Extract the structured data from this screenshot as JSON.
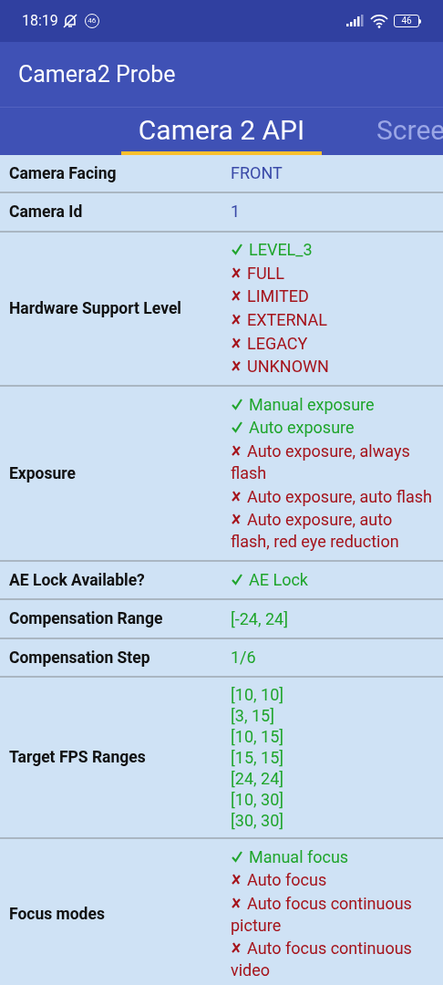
{
  "status_bar": {
    "time": "18:19",
    "notification_count": "46",
    "battery": "46"
  },
  "app_bar": {
    "title": "Camera2 Probe"
  },
  "tabs": [
    {
      "label": "Camera 2 API",
      "selected": true
    },
    {
      "label": "Scree",
      "selected": false
    }
  ],
  "rows": [
    {
      "label": "Camera Facing",
      "values": [
        {
          "kind": "info",
          "text": "FRONT"
        }
      ]
    },
    {
      "label": "Camera Id",
      "values": [
        {
          "kind": "info",
          "text": "1"
        }
      ]
    },
    {
      "label": "Hardware Support Level",
      "values": [
        {
          "kind": "feature",
          "text": "LEVEL_3",
          "supported": true
        },
        {
          "kind": "feature",
          "text": "FULL",
          "supported": false
        },
        {
          "kind": "feature",
          "text": "LIMITED",
          "supported": false
        },
        {
          "kind": "feature",
          "text": "EXTERNAL",
          "supported": false
        },
        {
          "kind": "feature",
          "text": "LEGACY",
          "supported": false
        },
        {
          "kind": "feature",
          "text": "UNKNOWN",
          "supported": false
        }
      ]
    },
    {
      "label": "Exposure",
      "values": [
        {
          "kind": "feature",
          "text": "Manual exposure",
          "supported": true
        },
        {
          "kind": "feature",
          "text": "Auto exposure",
          "supported": true
        },
        {
          "kind": "feature",
          "text": "Auto exposure, always flash",
          "supported": false
        },
        {
          "kind": "feature",
          "text": "Auto exposure, auto flash",
          "supported": false
        },
        {
          "kind": "feature",
          "text": "Auto exposure, auto flash, red eye reduction",
          "supported": false
        }
      ]
    },
    {
      "label": "AE Lock Available?",
      "values": [
        {
          "kind": "feature",
          "text": "AE Lock",
          "supported": true
        }
      ]
    },
    {
      "label": "Compensation Range",
      "values": [
        {
          "kind": "value",
          "text": "[-24, 24]"
        }
      ]
    },
    {
      "label": "Compensation Step",
      "values": [
        {
          "kind": "value",
          "text": "1/6"
        }
      ]
    },
    {
      "label": "Target FPS Ranges",
      "values": [
        {
          "kind": "value",
          "text": "[10, 10]"
        },
        {
          "kind": "value",
          "text": "[3, 15]"
        },
        {
          "kind": "value",
          "text": "[10, 15]"
        },
        {
          "kind": "value",
          "text": "[15, 15]"
        },
        {
          "kind": "value",
          "text": "[24, 24]"
        },
        {
          "kind": "value",
          "text": "[10, 30]"
        },
        {
          "kind": "value",
          "text": "[30, 30]"
        }
      ]
    },
    {
      "label": "Focus modes",
      "values": [
        {
          "kind": "feature",
          "text": "Manual focus",
          "supported": true
        },
        {
          "kind": "feature",
          "text": "Auto focus",
          "supported": false
        },
        {
          "kind": "feature",
          "text": "Auto focus continuous picture",
          "supported": false
        },
        {
          "kind": "feature",
          "text": "Auto focus continuous video",
          "supported": false
        }
      ]
    }
  ]
}
